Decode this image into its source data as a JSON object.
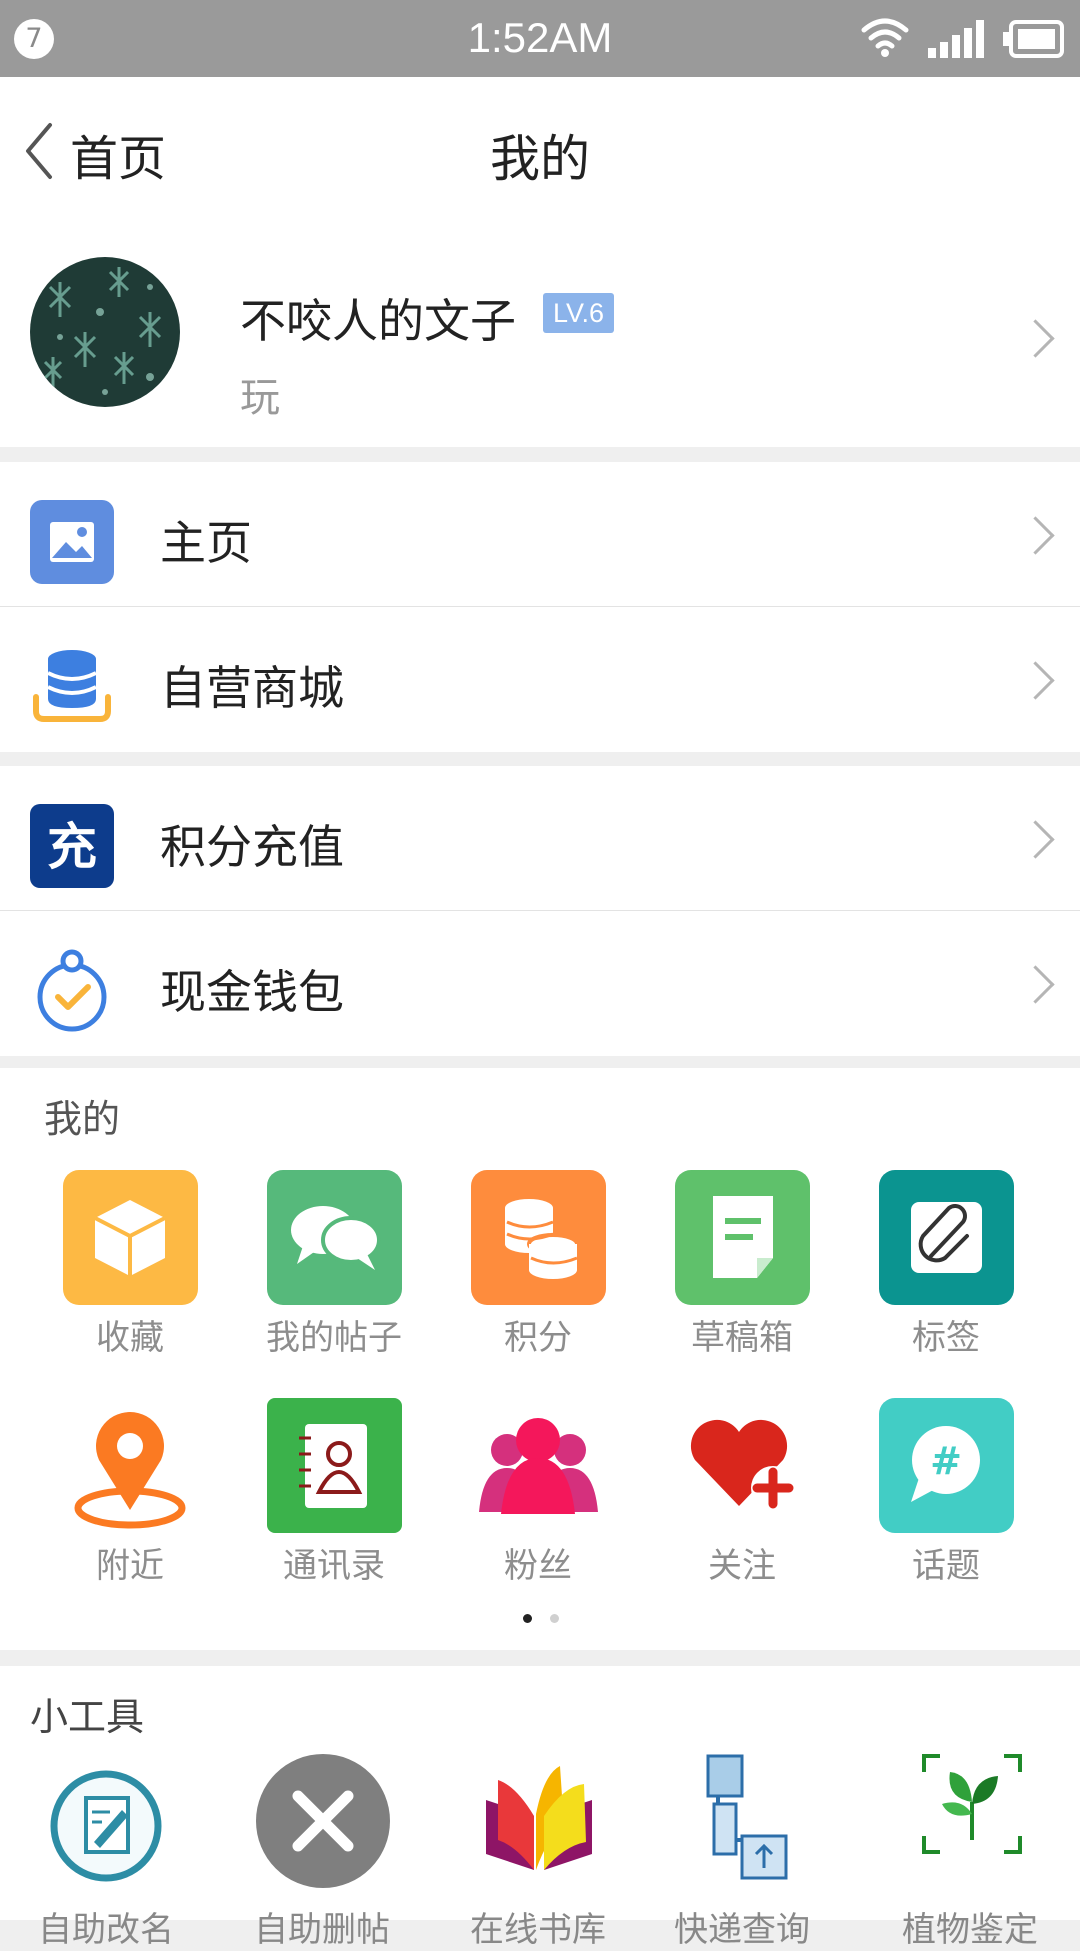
{
  "status_bar": {
    "badge": "7",
    "time": "1:52AM"
  },
  "nav": {
    "back_label": "首页",
    "title": "我的"
  },
  "profile": {
    "name": "不咬人的文子",
    "level": "LV.6",
    "subtitle": "玩"
  },
  "menu": [
    {
      "label": "主页",
      "icon": "image-icon"
    },
    {
      "label": "自营商城",
      "icon": "coin-stack-icon"
    },
    {
      "label": "积分充值",
      "icon": "recharge-icon"
    },
    {
      "label": "现金钱包",
      "icon": "clock-check-icon"
    }
  ],
  "mine": {
    "title": "我的",
    "items": [
      {
        "label": "收藏",
        "icon": "box-icon",
        "color": "#fdb944"
      },
      {
        "label": "我的帖子",
        "icon": "chat-bubbles-icon",
        "color": "#56b97b"
      },
      {
        "label": "积分",
        "icon": "coins-icon",
        "color": "#fe8c3d"
      },
      {
        "label": "草稿箱",
        "icon": "draft-icon",
        "color": "#5fc16b"
      },
      {
        "label": "标签",
        "icon": "paperclip-icon",
        "color": "#0b9490"
      },
      {
        "label": "附近",
        "icon": "location-pin-icon",
        "color": "#fb7a22"
      },
      {
        "label": "通讯录",
        "icon": "contacts-book-icon",
        "color": "#3bb24b"
      },
      {
        "label": "粉丝",
        "icon": "people-icon",
        "color": "#f4175b"
      },
      {
        "label": "关注",
        "icon": "heart-plus-icon",
        "color": "#d9261c"
      },
      {
        "label": "话题",
        "icon": "hashtag-bubble-icon",
        "color": "#42cdc5"
      }
    ]
  },
  "tools": {
    "title": "小工具",
    "items": [
      {
        "label": "自助改名",
        "icon": "edit-document-icon"
      },
      {
        "label": "自助删帖",
        "icon": "delete-x-icon"
      },
      {
        "label": "在线书库",
        "icon": "open-book-icon"
      },
      {
        "label": "快递查询",
        "icon": "delivery-icon"
      },
      {
        "label": "植物鉴定",
        "icon": "plant-scan-icon"
      }
    ]
  }
}
